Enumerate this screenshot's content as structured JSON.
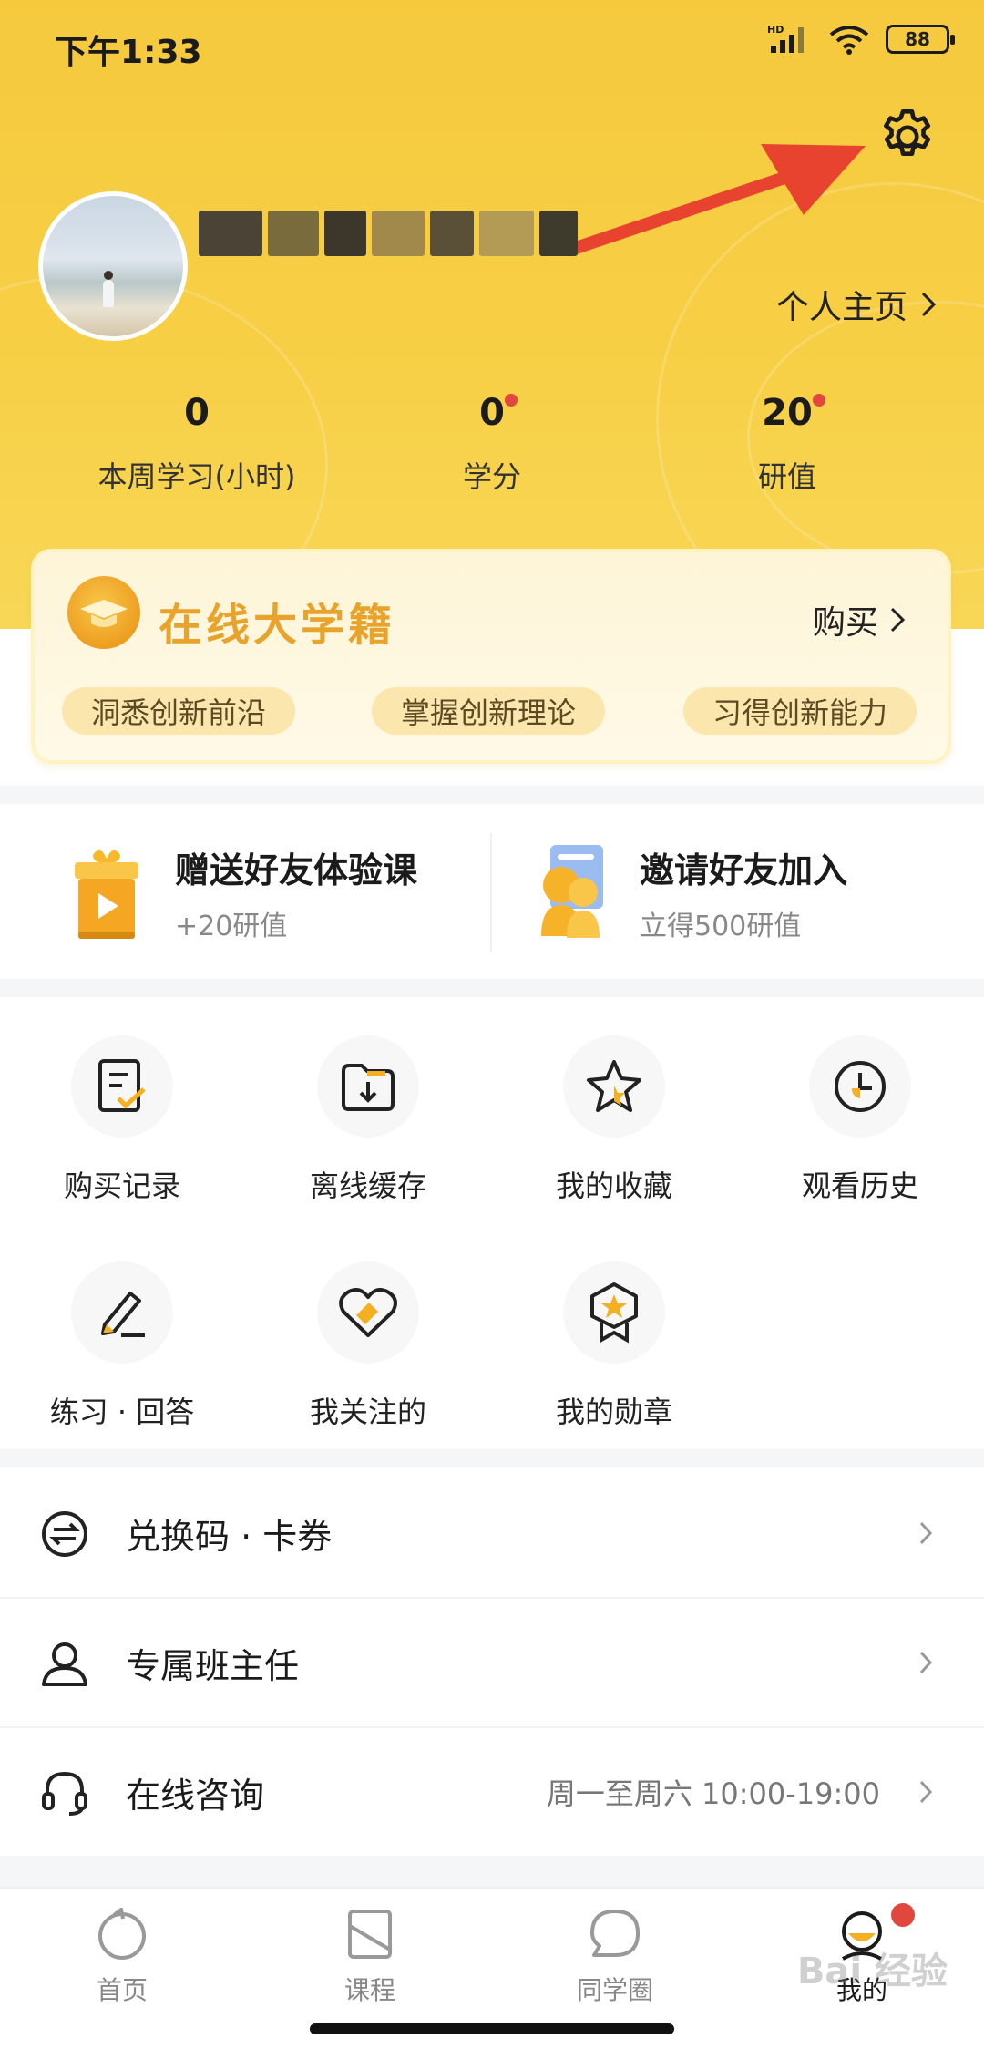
{
  "status_bar": {
    "time": "下午1:33",
    "battery": "88",
    "network": "HD"
  },
  "profile": {
    "homepage_label": "个人主页",
    "stats": [
      {
        "value": "0",
        "label": "本周学习(小时)",
        "badge": false
      },
      {
        "value": "0",
        "label": "学分",
        "badge": true
      },
      {
        "value": "20",
        "label": "研值",
        "badge": true
      }
    ]
  },
  "membership": {
    "title": "在线大学籍",
    "buy_label": "购买",
    "tags": [
      "洞悉创新前沿",
      "掌握创新理论",
      "习得创新能力"
    ]
  },
  "invite": [
    {
      "title": "赠送好友体验课",
      "subtitle": "+20研值",
      "icon": "gift-icon"
    },
    {
      "title": "邀请好友加入",
      "subtitle": "立得500研值",
      "icon": "invite-icon"
    }
  ],
  "grid": [
    {
      "label": "购买记录",
      "icon": "purchase-record-icon"
    },
    {
      "label": "离线缓存",
      "icon": "offline-cache-icon"
    },
    {
      "label": "我的收藏",
      "icon": "star-icon"
    },
    {
      "label": "观看历史",
      "icon": "clock-icon"
    },
    {
      "label": "练习 · 回答",
      "icon": "pencil-icon"
    },
    {
      "label": "我关注的",
      "icon": "heart-tag-icon"
    },
    {
      "label": "我的勋章",
      "icon": "medal-icon"
    }
  ],
  "list": [
    {
      "label": "兑换码 · 卡券",
      "right": "",
      "icon": "exchange-icon"
    },
    {
      "label": "专属班主任",
      "right": "",
      "icon": "person-icon"
    },
    {
      "label": "在线咨询",
      "right": "周一至周六 10:00-19:00",
      "icon": "headset-icon"
    }
  ],
  "nav": [
    {
      "label": "首页",
      "icon": "home-icon",
      "active": false
    },
    {
      "label": "课程",
      "icon": "course-icon",
      "active": false
    },
    {
      "label": "同学圈",
      "icon": "chat-icon",
      "active": false
    },
    {
      "label": "我的",
      "icon": "profile-icon",
      "active": true
    }
  ],
  "watermark": "Bai 经验",
  "colors": {
    "header": "#f6c93d",
    "accent": "#e7a32b",
    "badge": "#e2473d",
    "annotation_arrow": "#e8432e"
  }
}
